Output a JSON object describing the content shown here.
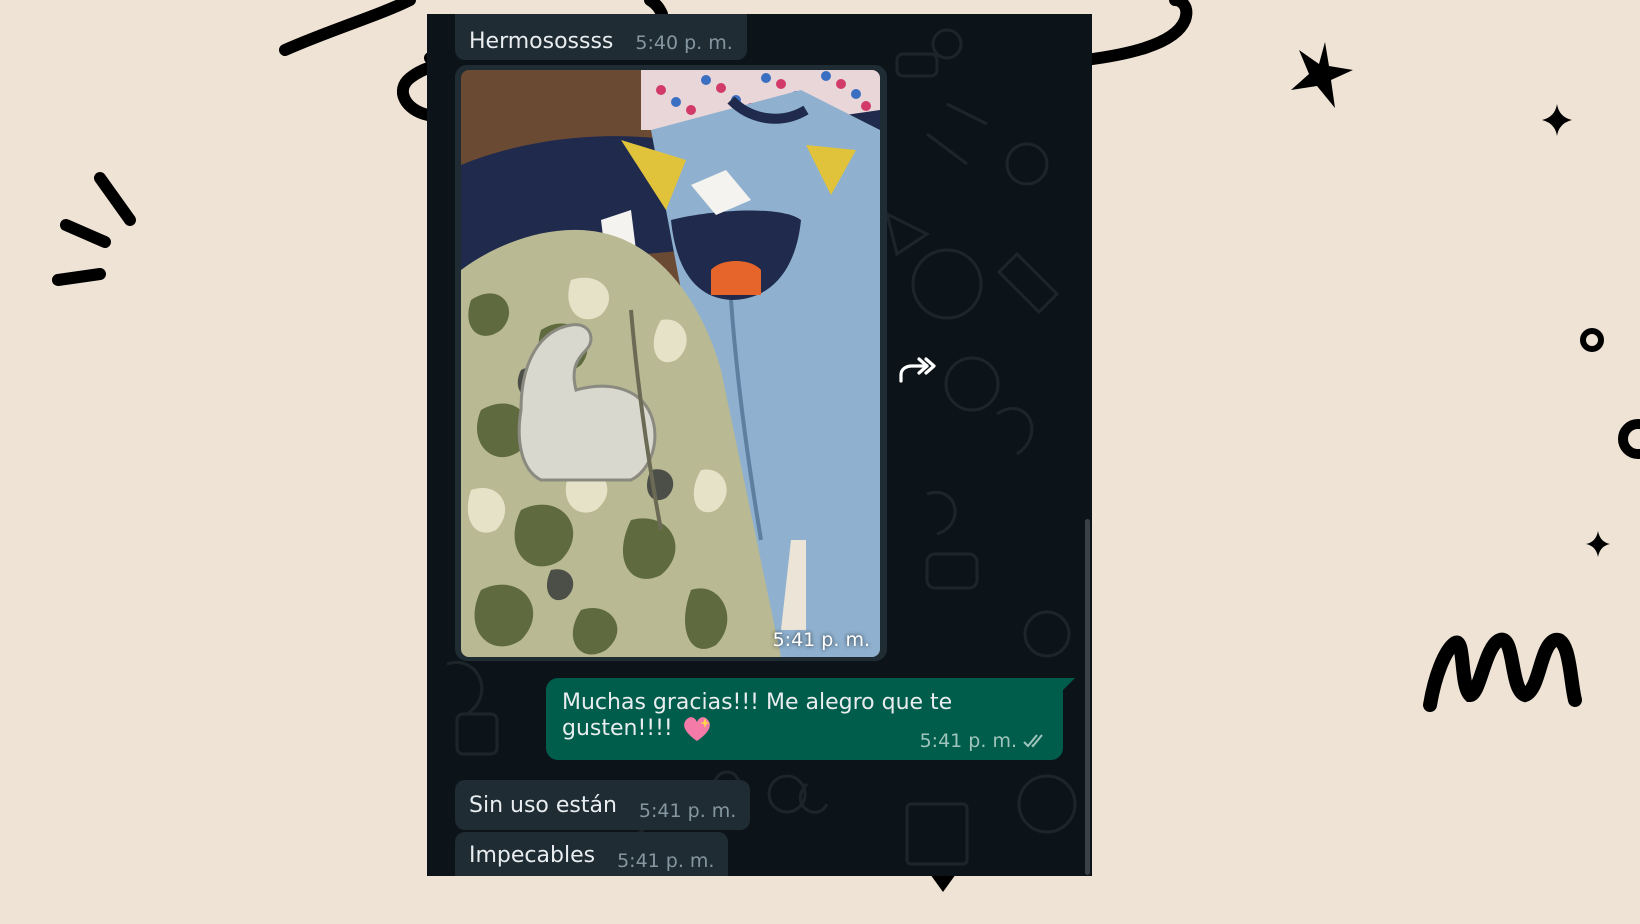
{
  "messages": [
    {
      "text": "Hermosossss",
      "time": "5:40 p. m."
    },
    {
      "time": "5:41 p. m."
    },
    {
      "text": "Muchas gracias!!! Me alegro que te gusten!!!!",
      "time": "5:41 p. m."
    },
    {
      "text": "Sin uso están",
      "time": "5:41 p. m."
    },
    {
      "text": "Impecables",
      "time": "5:41 p. m."
    }
  ],
  "colors": {
    "page_bg": "#eee3d5",
    "chat_bg": "#0c141a",
    "incoming_bubble": "#1f2c34",
    "outgoing_bubble": "#005c4b",
    "meta_text": "#8696a0"
  },
  "icons": {
    "forward": "forward-icon",
    "read_receipt": "double-check-icon",
    "emoji": "sparkling-heart-icon"
  }
}
